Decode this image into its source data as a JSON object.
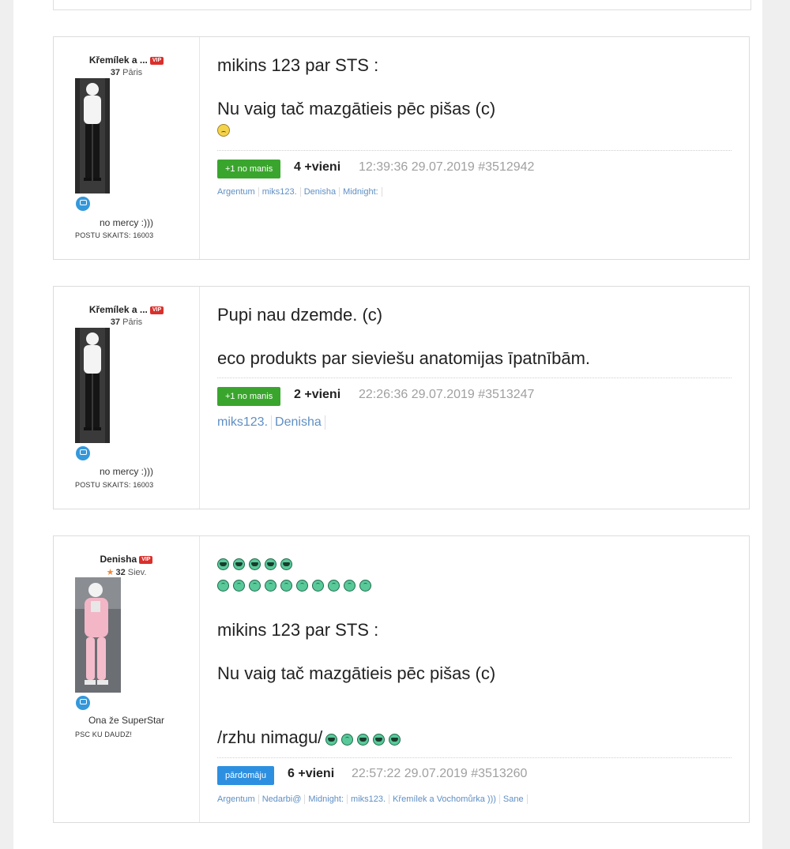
{
  "posts": [
    {
      "author": {
        "name": "Křemílek a ...",
        "badge": "VIP",
        "age": "37",
        "location": "Pāris",
        "motto": "no mercy :)))",
        "post_count": "POSTU SKAITS: 16003"
      },
      "lines": [
        "mikins 123 par STS :",
        "Nu vaig tač mazgātieis pēc pišas (c)"
      ],
      "vote_button": "+1 no manis",
      "plus_count": "4 +vieni",
      "timestamp": "12:39:36 29.07.2019 #3512942",
      "voters": [
        "Argentum",
        "miks123.",
        "Denisha",
        "Midnight:"
      ]
    },
    {
      "author": {
        "name": "Křemílek a ...",
        "badge": "VIP",
        "age": "37",
        "location": "Pāris",
        "motto": "no mercy :)))",
        "post_count": "POSTU SKAITS: 16003"
      },
      "lines": [
        "Pupi nau dzemde. (c)",
        "eco produkts par sieviešu anatomijas īpatnībām."
      ],
      "vote_button": "+1 no manis",
      "plus_count": "2 +vieni",
      "timestamp": "22:26:36 29.07.2019 #3513247",
      "voters": [
        "miks123.",
        "Denisha"
      ]
    },
    {
      "author": {
        "name": "Denisha",
        "badge": "VIP",
        "age": "32",
        "location": "Siev.",
        "motto": "Ona že SuperStar",
        "post_count": "PSC KU DAUDZ!"
      },
      "lines": [
        "mikins 123 par STS :",
        "Nu vaig tač mazgātieis pēc pišas (c)",
        "/rzhu nimagu/"
      ],
      "vote_button": "pārdomāju",
      "plus_count": "6 +vieni",
      "timestamp": "22:57:22 29.07.2019 #3513260",
      "voters": [
        "Argentum",
        "Nedarbi@",
        "Midnight:",
        "miks123.",
        "Křemílek a Vochomůrka )))",
        "Sane"
      ]
    }
  ],
  "icons": {
    "message": "speech-bubble-icon",
    "emoji_laugh": "laughing-face-emoji",
    "emoji_smile": "smiling-face-emoji",
    "emoji_sad": "sad-face-emoji",
    "star": "star-icon"
  },
  "colors": {
    "vip_badge": "#d9302c",
    "vote_green": "#3aa52d",
    "vote_blue": "#2d8fe0",
    "link": "#5f8fc4",
    "emoji": "#59c99a"
  }
}
